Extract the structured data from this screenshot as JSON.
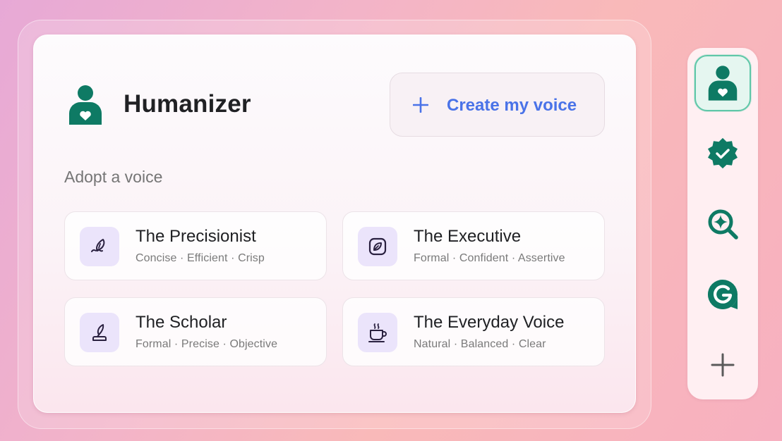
{
  "app": {
    "title": "Humanizer"
  },
  "create_button": {
    "label": "Create my voice"
  },
  "section": {
    "label": "Adopt a voice"
  },
  "voices": [
    {
      "title": "The Precisionist",
      "traits": "Concise · Efficient · Crisp",
      "icon": "pen-nib-icon"
    },
    {
      "title": "The Executive",
      "traits": "Formal · Confident · Assertive",
      "icon": "leaf-square-icon"
    },
    {
      "title": "The Scholar",
      "traits": "Formal · Precise · Objective",
      "icon": "quill-inkpot-icon"
    },
    {
      "title": "The Everyday Voice",
      "traits": "Natural · Balanced · Clear",
      "icon": "coffee-cup-icon"
    }
  ],
  "dock": {
    "items": [
      "humanizer-icon",
      "verified-badge-icon",
      "ai-search-icon",
      "grammarly-icon",
      "add-icon"
    ],
    "active": "humanizer-icon"
  },
  "colors": {
    "accent_green": "#0e7a64",
    "accent_blue": "#4a73e8",
    "voice_icon_bg": "#ebe4fb",
    "voice_icon_stroke": "#2a2140"
  }
}
